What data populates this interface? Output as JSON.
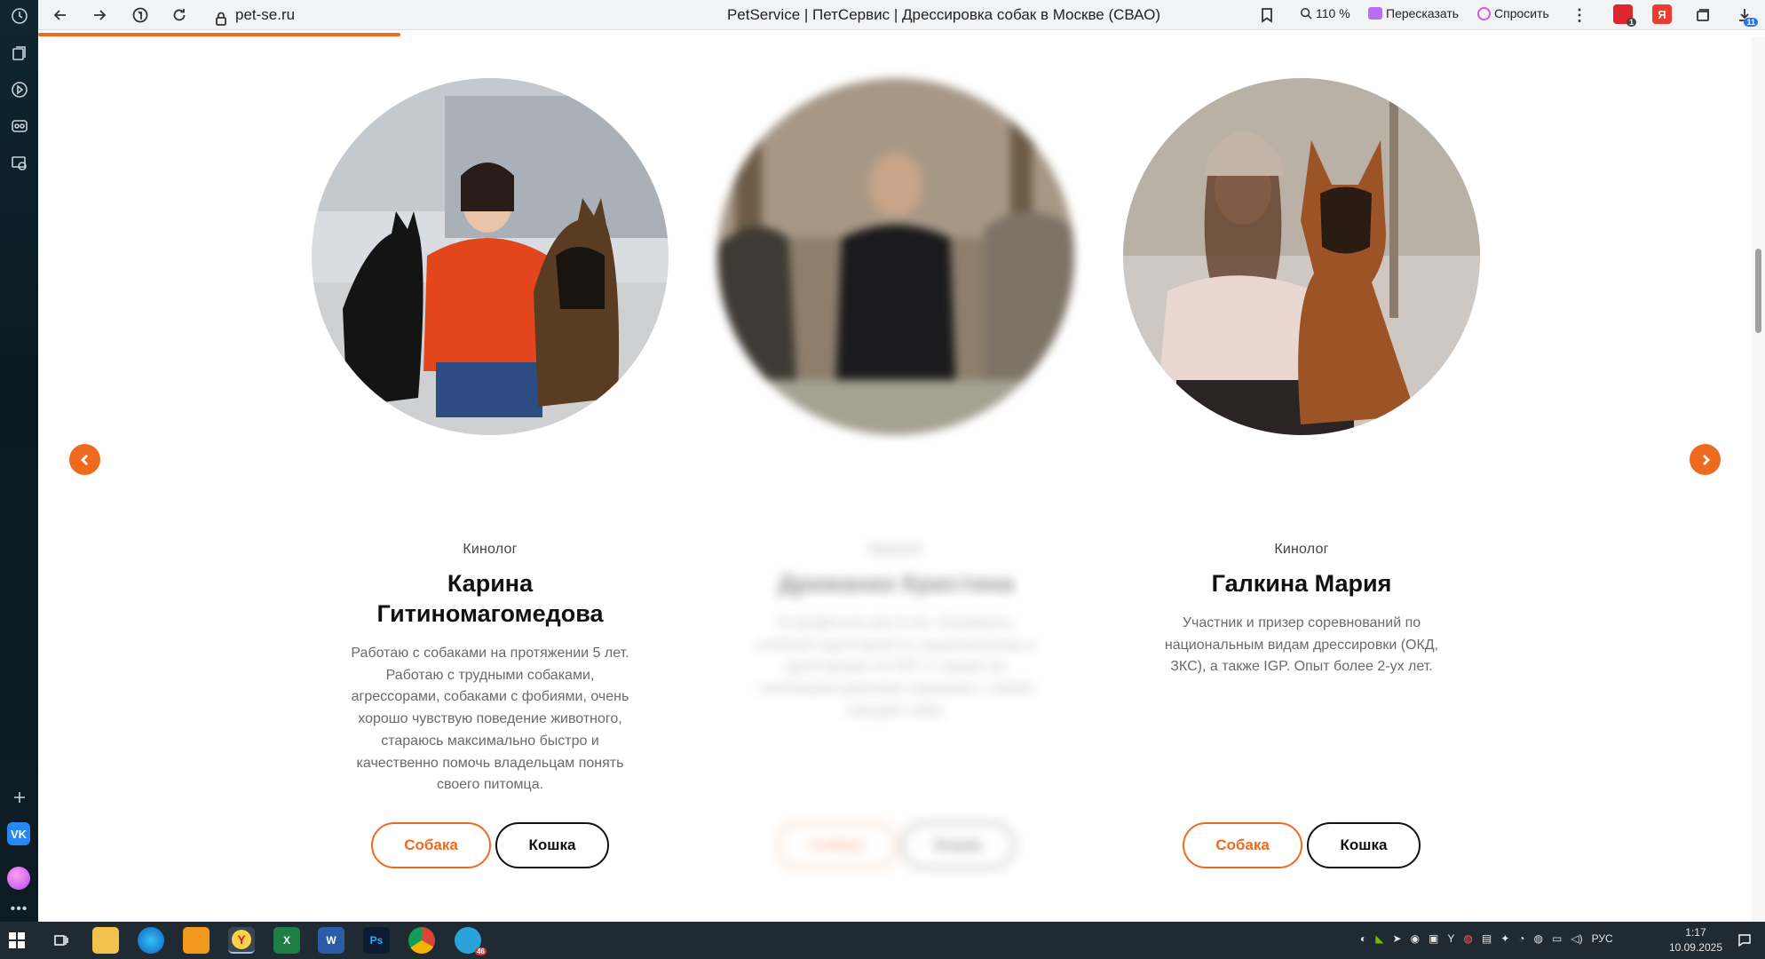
{
  "browser": {
    "url": "pet-se.ru",
    "tab_title": "PetService | ПетСервис | Дрессировка собак в Москве (СВАО)",
    "zoom": "110 %",
    "retell_label": "Пересказать",
    "ask_label": "Спросить",
    "ext_badge_1": "1",
    "ext_badge_downloads": "11",
    "page_load_progress": 0.21
  },
  "sidebar": {
    "icons": [
      "history-icon",
      "collections-icon",
      "video-icon",
      "games-icon",
      "screenshot-icon"
    ],
    "vk_label": "VK"
  },
  "trainers": [
    {
      "role": "Кинолог",
      "name": "Карина Гитиномагомедова",
      "description": "Работаю с собаками на протяжении 5 лет. Работаю с трудными собаками, агрессорами, собаками с фобиями, очень хорошо чувствую поведение животного, стараюсь максимально быстро и качественно помочь владельцам понять своего питомца.",
      "dog_label": "Собака",
      "cat_label": "Кошка"
    },
    {
      "role": "Кинолог",
      "name": "Дрижанко Кристина",
      "description": "В профессии уже 8 лет. Занимаюсь учебной подготовкой по национальному и дрессировке по IGP. С такими же ключевыми рабочими навыками с любой породой собак.",
      "dog_label": "Собака",
      "cat_label": "Кошка"
    },
    {
      "role": "Кинолог",
      "name": "Галкина Мария",
      "description": "Участник и призер соревнований по национальным видам дрессировки (ОКД, ЗКС), а также IGP. Опыт более 2-ух лет.",
      "dog_label": "Собака",
      "cat_label": "Кошка"
    }
  ],
  "taskbar": {
    "apps": [
      "start-icon",
      "task-view-icon",
      "file-explorer-icon",
      "edge-icon",
      "outlook-icon",
      "yandex-browser-icon",
      "excel-icon",
      "word-icon",
      "photoshop-icon",
      "chrome-icon",
      "telegram-icon"
    ],
    "ps_label": "Ps",
    "word_label": "W",
    "excel_label": "X",
    "telegram_badge": "46",
    "language": "РУС",
    "time": "1:17",
    "date": "10.09.2025"
  },
  "colors": {
    "accent": "#ee6a1e",
    "dark_text": "#111111",
    "muted_text": "#6a6a6a"
  }
}
